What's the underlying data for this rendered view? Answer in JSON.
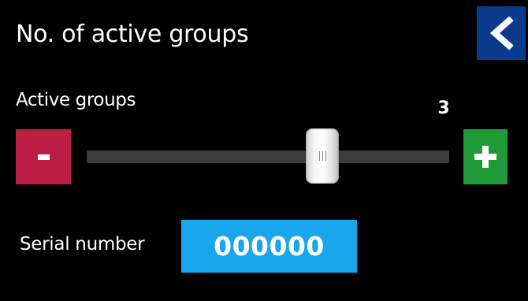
{
  "header": {
    "title": "No. of active groups",
    "back_icon": "chevron-left-icon",
    "back_color": "#0a3a8c"
  },
  "active_groups": {
    "label": "Active groups",
    "value": "3",
    "slider_fraction": 0.65,
    "minus_label": "-",
    "minus_color": "#bc1e43",
    "plus_icon": "plus-icon",
    "plus_color": "#1f9a36"
  },
  "serial": {
    "label": "Serial number",
    "value": "000000",
    "field_color": "#19a6ec"
  }
}
